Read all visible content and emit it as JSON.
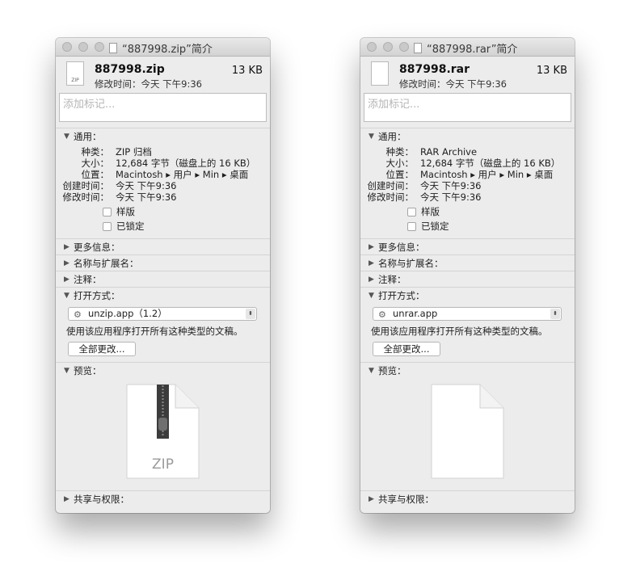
{
  "common": {
    "modified_prefix": "修改时间：今天 下午9:36",
    "tags_placeholder": "添加标记...",
    "general_header": "通用：",
    "labels": {
      "kind": "种类：",
      "size": "大小：",
      "where": "位置：",
      "created": "创建时间：",
      "modified": "修改时间："
    },
    "checkbox_stationery": "样版",
    "checkbox_locked": "已锁定",
    "more_info": "更多信息：",
    "name_ext": "名称与扩展名：",
    "comments": "注释：",
    "open_with": "打开方式：",
    "open_with_desc": "使用该应用程序打开所有这种类型的文稿。",
    "change_all": "全部更改...",
    "preview": "预览：",
    "sharing": "共享与权限："
  },
  "windows": [
    {
      "title": "“887998.zip”简介",
      "filename": "887998.zip",
      "size_short": "13 KB",
      "icon_label": "ZIP",
      "kind": "ZIP 归档",
      "size_full": "12,684 字节（磁盘上的 16 KB）",
      "where": "Macintosh ▸ 用户 ▸ Min ▸ 桌面",
      "created": "今天 下午9:36",
      "modified": "今天 下午9:36",
      "app": "unzip.app（1.2）",
      "preview_text": "ZIP"
    },
    {
      "title": "“887998.rar”简介",
      "filename": "887998.rar",
      "size_short": "13 KB",
      "icon_label": "",
      "kind": "RAR Archive",
      "size_full": "12,684 字节（磁盘上的 16 KB）",
      "where": "Macintosh ▸ 用户 ▸ Min ▸ 桌面",
      "created": "今天 下午9:36",
      "modified": "今天 下午9:36",
      "app": "unrar.app",
      "preview_text": ""
    }
  ]
}
